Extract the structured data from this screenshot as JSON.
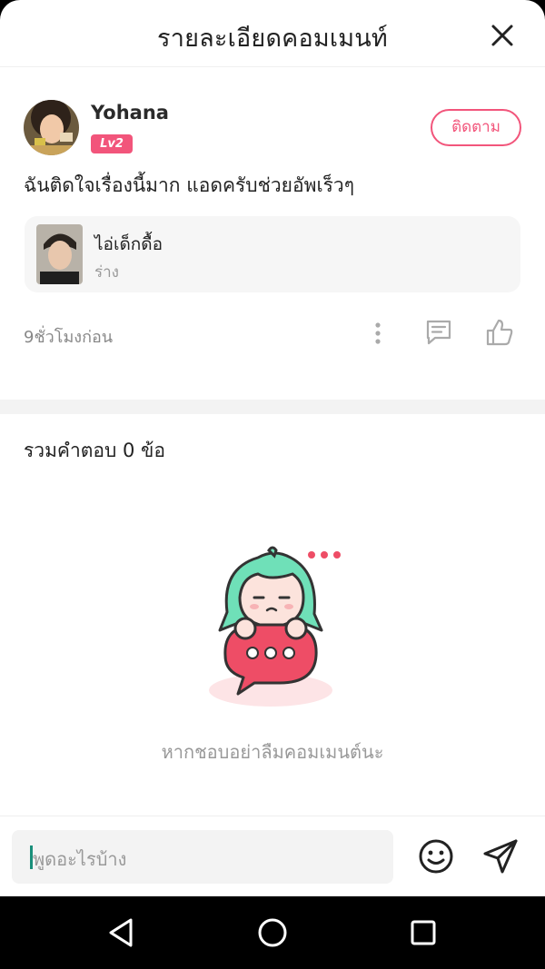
{
  "header": {
    "title": "รายละเอียดคอมเมนท์"
  },
  "comment": {
    "username": "Yohana",
    "level": "Lv2",
    "follow_label": "ติดตาม",
    "text": "ฉันติดใจเรื่องนี้มาก แอดครับช่วยอัพเร็วๆ",
    "book": {
      "title": "ไอ่เด็กดื้อ",
      "status": "ร่าง"
    },
    "timestamp": "9ชั่วโมงก่อน"
  },
  "replies": {
    "count_label": "รวมคำตอบ 0 ข้อ",
    "empty_message": "หากชอบอย่าลืมคอมเมนต์นะ"
  },
  "input": {
    "placeholder": "พูดอะไรบ้าง"
  },
  "colors": {
    "accent": "#f2557b",
    "caret": "#1a8f7a",
    "mascot_hair": "#6fe0b8",
    "mascot_bubble": "#ee4d66"
  },
  "icons": [
    "close-icon",
    "more-icon",
    "reply-icon",
    "like-icon",
    "emoji-icon",
    "send-icon",
    "nav-back-icon",
    "nav-home-icon",
    "nav-recents-icon"
  ]
}
